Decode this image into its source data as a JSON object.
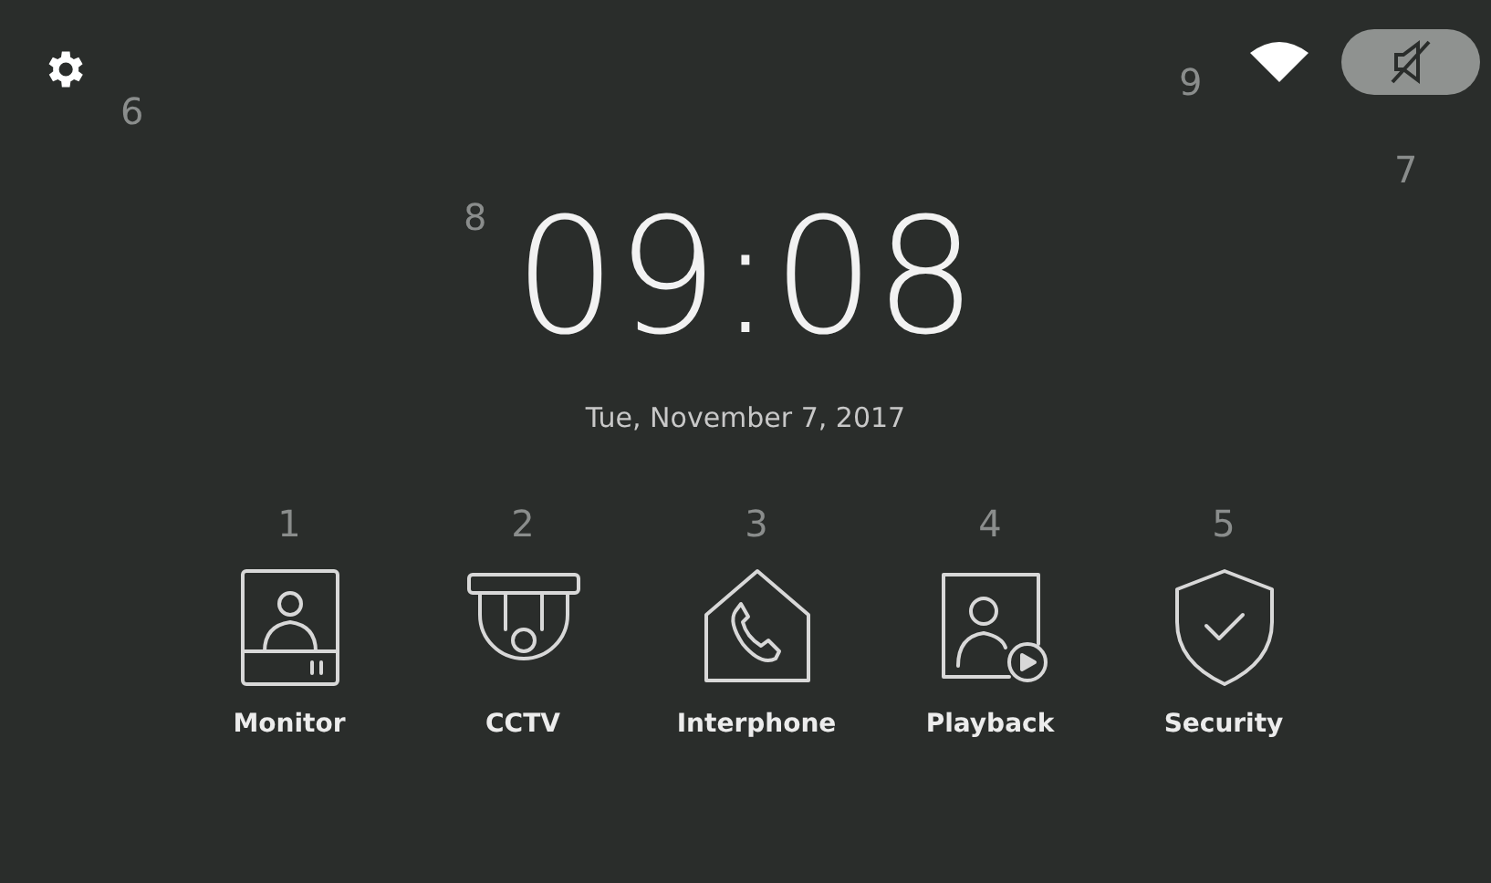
{
  "top_bar": {
    "mute": {
      "muted": true
    }
  },
  "clock": {
    "time": "09:08",
    "date": "Tue, November 7, 2017"
  },
  "apps": [
    {
      "kind": "monitor",
      "label": "Monitor",
      "callout": "1"
    },
    {
      "kind": "cctv",
      "label": "CCTV",
      "callout": "2"
    },
    {
      "kind": "interphone",
      "label": "Interphone",
      "callout": "3"
    },
    {
      "kind": "playback",
      "label": "Playback",
      "callout": "4"
    },
    {
      "kind": "security",
      "label": "Security",
      "callout": "5"
    }
  ],
  "callouts": {
    "settings": "6",
    "mute": "7",
    "clock": "8",
    "wifi": "9"
  }
}
